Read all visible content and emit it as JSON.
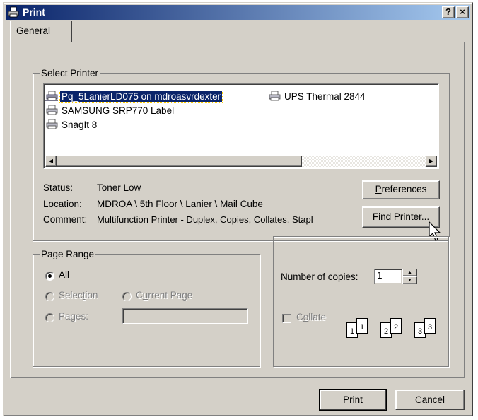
{
  "window": {
    "title": "Print",
    "help_label": "?",
    "close_label": "×"
  },
  "tabs": [
    {
      "label": "General"
    }
  ],
  "select_printer": {
    "group_label": "Select Printer",
    "printers": [
      {
        "name": "Pq_5LanierLD075 on mdroasvrdexter",
        "selected": true,
        "icon": "network-printer-icon"
      },
      {
        "name": "UPS Thermal 2844",
        "selected": false,
        "icon": "printer-icon"
      },
      {
        "name": "SAMSUNG SRP770 Label",
        "selected": false,
        "icon": "printer-icon"
      },
      {
        "name": "SnagIt 8",
        "selected": false,
        "icon": "printer-icon"
      }
    ],
    "status_label": "Status:",
    "status_value": "Toner Low",
    "location_label": "Location:",
    "location_value": "MDROA \\ 5th Floor \\ Lanier \\ Mail Cube",
    "comment_label": "Comment:",
    "comment_value": "Multifunction Printer - Duplex, Copies, Collates, Stapl",
    "preferences_button": {
      "pre": "",
      "accel": "P",
      "post": "references"
    },
    "find_printer_button": {
      "pre": "Fin",
      "accel": "d",
      "post": " Printer..."
    }
  },
  "page_range": {
    "group_label": "Page Range",
    "all_option": {
      "pre": "A",
      "accel": "l",
      "post": "l",
      "checked": true
    },
    "selection_option": {
      "pre": "Selec",
      "accel": "t",
      "post": "ion",
      "enabled": false
    },
    "current_page_option": {
      "pre": "C",
      "accel": "u",
      "post": "rrent Page",
      "enabled": false
    },
    "pages_option": {
      "pre": "Pa",
      "accel": "g",
      "post": "es:",
      "enabled": false
    },
    "pages_value": ""
  },
  "copies": {
    "number_label": {
      "pre": "Number of ",
      "accel": "c",
      "post": "opies:"
    },
    "number_value": "1",
    "collate_label": {
      "pre": "C",
      "accel": "o",
      "post": "llate"
    },
    "collate_checked": false,
    "collate_pages": [
      "1",
      "1",
      "2",
      "2",
      "3",
      "3"
    ]
  },
  "buttons": {
    "print": {
      "pre": "",
      "accel": "P",
      "post": "rint"
    },
    "cancel": "Cancel"
  },
  "colors": {
    "face": "#d4d0c8",
    "title_start": "#0a246a",
    "title_end": "#a6caf0",
    "selection": "#0a246a"
  }
}
